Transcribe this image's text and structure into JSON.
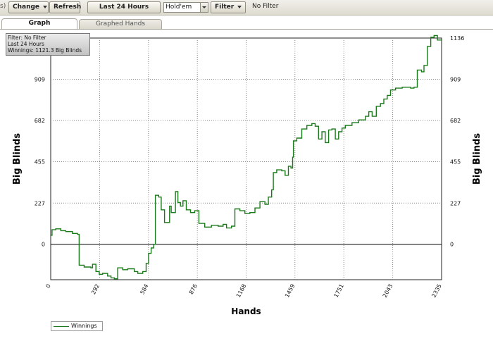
{
  "toolbar": {
    "edge_text": "s)",
    "change_label": "Change",
    "refresh_label": "Refresh",
    "time_label": "Last 24 Hours",
    "game_select": "Hold'em",
    "filter_label": "Filter",
    "status_text": "No Filter"
  },
  "tabs": [
    {
      "label": "Graph"
    },
    {
      "label": "Graphed Hands"
    }
  ],
  "annotation": {
    "filter": "Filter: No Filter",
    "time": "Last  24 Hours",
    "winnings": "Winnings: 1121.3 Big Blinds"
  },
  "legend": {
    "label": "Winnings"
  },
  "colors": {
    "series": "#1a7a1a",
    "zero_line": "#000000",
    "grid": "#888888"
  },
  "chart_data": {
    "type": "line",
    "xlabel": "Hands",
    "ylabel": "Big Blinds",
    "ylabel_right": "Big Blinds",
    "x_ticks": [
      "0",
      "292",
      "584",
      "876",
      "1168",
      "1459",
      "1751",
      "2043",
      "2335"
    ],
    "y_ticks": [
      "0",
      "227",
      "455",
      "682",
      "909",
      "1136"
    ],
    "xlim": [
      0,
      2335
    ],
    "ylim": [
      -195,
      1136
    ],
    "grid": true,
    "legend_position": "bottom-left",
    "series": [
      {
        "name": "Winnings",
        "points": [
          [
            0,
            50
          ],
          [
            8,
            80
          ],
          [
            30,
            85
          ],
          [
            60,
            75
          ],
          [
            90,
            70
          ],
          [
            130,
            60
          ],
          [
            160,
            55
          ],
          [
            170,
            -115
          ],
          [
            200,
            -125
          ],
          [
            240,
            -130
          ],
          [
            250,
            -110
          ],
          [
            270,
            -150
          ],
          [
            290,
            -165
          ],
          [
            310,
            -160
          ],
          [
            340,
            -175
          ],
          [
            360,
            -185
          ],
          [
            380,
            -190
          ],
          [
            400,
            -130
          ],
          [
            430,
            -140
          ],
          [
            460,
            -135
          ],
          [
            500,
            -150
          ],
          [
            520,
            -160
          ],
          [
            550,
            -150
          ],
          [
            570,
            -105
          ],
          [
            585,
            -50
          ],
          [
            600,
            -20
          ],
          [
            615,
            0
          ],
          [
            625,
            270
          ],
          [
            645,
            260
          ],
          [
            660,
            190
          ],
          [
            680,
            120
          ],
          [
            710,
            210
          ],
          [
            720,
            175
          ],
          [
            745,
            290
          ],
          [
            760,
            230
          ],
          [
            775,
            210
          ],
          [
            790,
            240
          ],
          [
            810,
            190
          ],
          [
            835,
            175
          ],
          [
            860,
            185
          ],
          [
            885,
            115
          ],
          [
            920,
            95
          ],
          [
            960,
            105
          ],
          [
            1000,
            100
          ],
          [
            1030,
            110
          ],
          [
            1050,
            90
          ],
          [
            1080,
            100
          ],
          [
            1100,
            195
          ],
          [
            1130,
            185
          ],
          [
            1160,
            170
          ],
          [
            1190,
            175
          ],
          [
            1220,
            200
          ],
          [
            1250,
            235
          ],
          [
            1280,
            220
          ],
          [
            1300,
            260
          ],
          [
            1320,
            300
          ],
          [
            1330,
            395
          ],
          [
            1350,
            410
          ],
          [
            1380,
            405
          ],
          [
            1400,
            380
          ],
          [
            1420,
            430
          ],
          [
            1435,
            420
          ],
          [
            1445,
            480
          ],
          [
            1450,
            570
          ],
          [
            1470,
            585
          ],
          [
            1500,
            635
          ],
          [
            1530,
            655
          ],
          [
            1560,
            665
          ],
          [
            1580,
            650
          ],
          [
            1600,
            580
          ],
          [
            1620,
            620
          ],
          [
            1640,
            560
          ],
          [
            1660,
            630
          ],
          [
            1680,
            635
          ],
          [
            1700,
            580
          ],
          [
            1720,
            620
          ],
          [
            1740,
            640
          ],
          [
            1760,
            655
          ],
          [
            1800,
            670
          ],
          [
            1840,
            685
          ],
          [
            1880,
            705
          ],
          [
            1900,
            730
          ],
          [
            1920,
            705
          ],
          [
            1945,
            760
          ],
          [
            1970,
            775
          ],
          [
            1990,
            800
          ],
          [
            2010,
            820
          ],
          [
            2030,
            850
          ],
          [
            2060,
            860
          ],
          [
            2100,
            865
          ],
          [
            2150,
            860
          ],
          [
            2170,
            865
          ],
          [
            2190,
            960
          ],
          [
            2215,
            950
          ],
          [
            2230,
            985
          ],
          [
            2250,
            1090
          ],
          [
            2270,
            1140
          ],
          [
            2290,
            1150
          ],
          [
            2310,
            1125
          ],
          [
            2335,
            1121.3
          ]
        ]
      }
    ]
  }
}
